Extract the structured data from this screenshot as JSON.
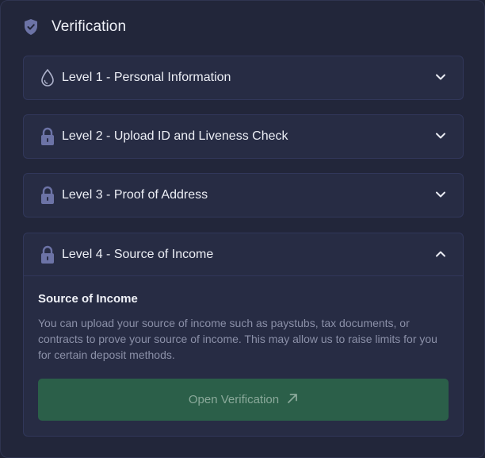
{
  "header": {
    "title": "Verification",
    "icon": "shield-check-icon"
  },
  "levels": [
    {
      "label": "Level 1 - Personal Information",
      "icon": "water-drop-icon",
      "state": "collapsed"
    },
    {
      "label": "Level 2 - Upload ID and Liveness Check",
      "icon": "lock-icon",
      "state": "collapsed"
    },
    {
      "label": "Level 3 - Proof of Address",
      "icon": "lock-icon",
      "state": "collapsed"
    },
    {
      "label": "Level 4 - Source of Income",
      "icon": "lock-icon",
      "state": "expanded"
    }
  ],
  "level4_body": {
    "title": "Source of Income",
    "description": "You can upload your source of income such as paystubs, tax documents, or contracts to prove your source of income. This may allow us to raise limits for you for certain deposit methods.",
    "button_label": "Open Verification",
    "button_icon": "arrow-up-right-icon"
  },
  "colors": {
    "background": "#22263a",
    "card": "#272c44",
    "accent_button": "#2b5f49",
    "icon_lock": "#6c73a6"
  }
}
